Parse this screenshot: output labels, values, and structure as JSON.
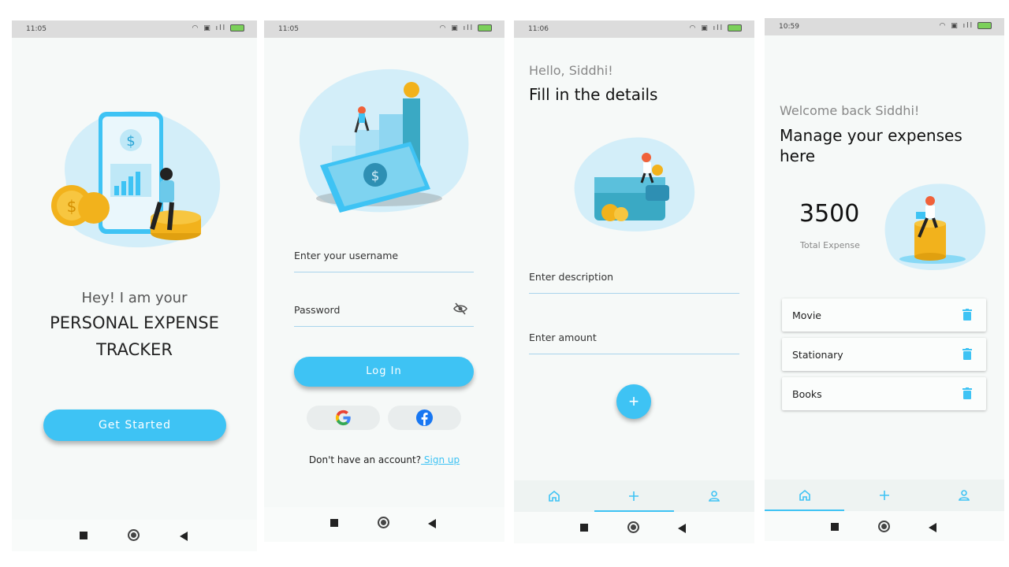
{
  "status_bar": [
    {
      "time": "11:05"
    },
    {
      "time": "11:05"
    },
    {
      "time": "11:06"
    },
    {
      "time": "10:59"
    }
  ],
  "colors": {
    "accent": "#3ec3f4",
    "background": "#f6f9f8",
    "blob": "#d3eef9"
  },
  "screen1": {
    "greeting": "Hey! I am your",
    "title_line1": "PERSONAL EXPENSE",
    "title_line2": "TRACKER",
    "button": "Get Started"
  },
  "screen2": {
    "username_label": "Enter your username",
    "password_label": "Password",
    "login_button": "Log In",
    "signup_prompt": "Don't have an account?",
    "signup_link": " Sign up",
    "social": [
      "google-icon",
      "facebook-icon"
    ]
  },
  "screen3": {
    "greeting": "Hello, Siddhi!",
    "title": "Fill in the details",
    "description_label": "Enter description",
    "amount_label": "Enter amount",
    "fab": "+"
  },
  "screen4": {
    "greeting": "Welcome back Siddhi!",
    "title_line1": "Manage your expenses",
    "title_line2": "here",
    "total_value": "3500",
    "total_label": "Total Expense",
    "expenses": [
      {
        "name": "Movie"
      },
      {
        "name": "Stationary"
      },
      {
        "name": "Books"
      }
    ]
  },
  "bottom_nav": [
    "home-icon",
    "add-icon",
    "profile-icon"
  ]
}
